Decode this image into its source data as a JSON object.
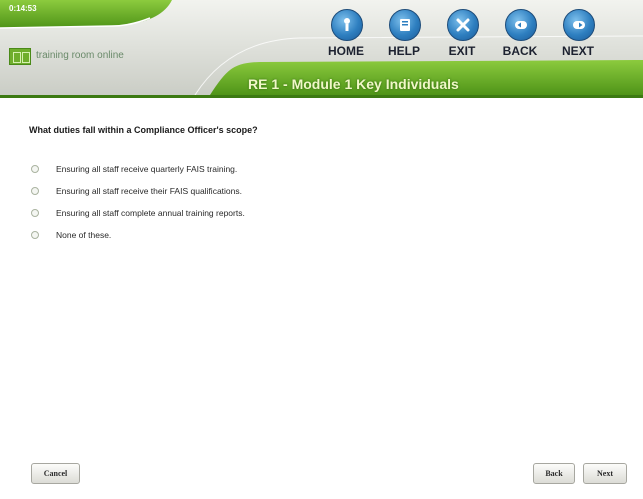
{
  "timer": "0:14:53",
  "logo": {
    "name": "training room online",
    "tagline": ""
  },
  "nav": [
    {
      "id": "home",
      "label": "HOME",
      "icon": "home-icon"
    },
    {
      "id": "help",
      "label": "HELP",
      "icon": "help-icon"
    },
    {
      "id": "exit",
      "label": "EXIT",
      "icon": "exit-icon"
    },
    {
      "id": "back",
      "label": "BACK",
      "icon": "back-arrow-icon"
    },
    {
      "id": "next",
      "label": "NEXT",
      "icon": "next-arrow-icon"
    }
  ],
  "module_title": "RE 1 - Module 1 Key Individuals",
  "question": "What duties fall within a Compliance Officer's scope?",
  "options": [
    "Ensuring all staff receive quarterly FAIS training.",
    "Ensuring all staff receive their FAIS qualifications.",
    "Ensuring all staff complete annual training reports.",
    "None of these."
  ],
  "footer": {
    "cancel_label": "Cancel",
    "back_label": "Back",
    "next_label": "Next"
  },
  "colors": {
    "header_green": "#6fae2c",
    "header_grey": "#d9dbd6",
    "nav_blue": "#2e7fc0"
  }
}
